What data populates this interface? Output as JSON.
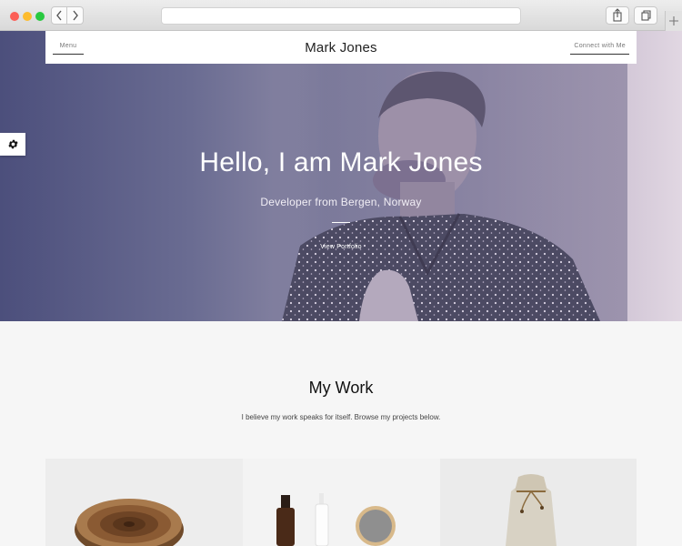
{
  "browser": {
    "back_icon": "chevron-left",
    "forward_icon": "chevron-right",
    "share_icon": "share-icon",
    "tabs_icon": "tabs-icon",
    "new_tab_icon": "plus"
  },
  "site": {
    "menu_label": "Menu",
    "title": "Mark Jones",
    "connect_label": "Connect with Me",
    "settings_icon": "gear-icon"
  },
  "hero": {
    "heading": "Hello, I am Mark Jones",
    "subheading": "Developer from Bergen, Norway",
    "cta_label": "View Portfolio",
    "gradient_colors": [
      "#4c4f7c",
      "#8e8aa6",
      "#e1d7e2"
    ]
  },
  "work": {
    "title": "My Work",
    "description": "I believe my work speaks for itself. Browse my projects below.",
    "projects": [
      {
        "name": "wood-slice-project",
        "image": "wood slice"
      },
      {
        "name": "cosmetics-project",
        "image": "bottles and jar"
      },
      {
        "name": "sack-project",
        "image": "linen sack"
      }
    ]
  }
}
